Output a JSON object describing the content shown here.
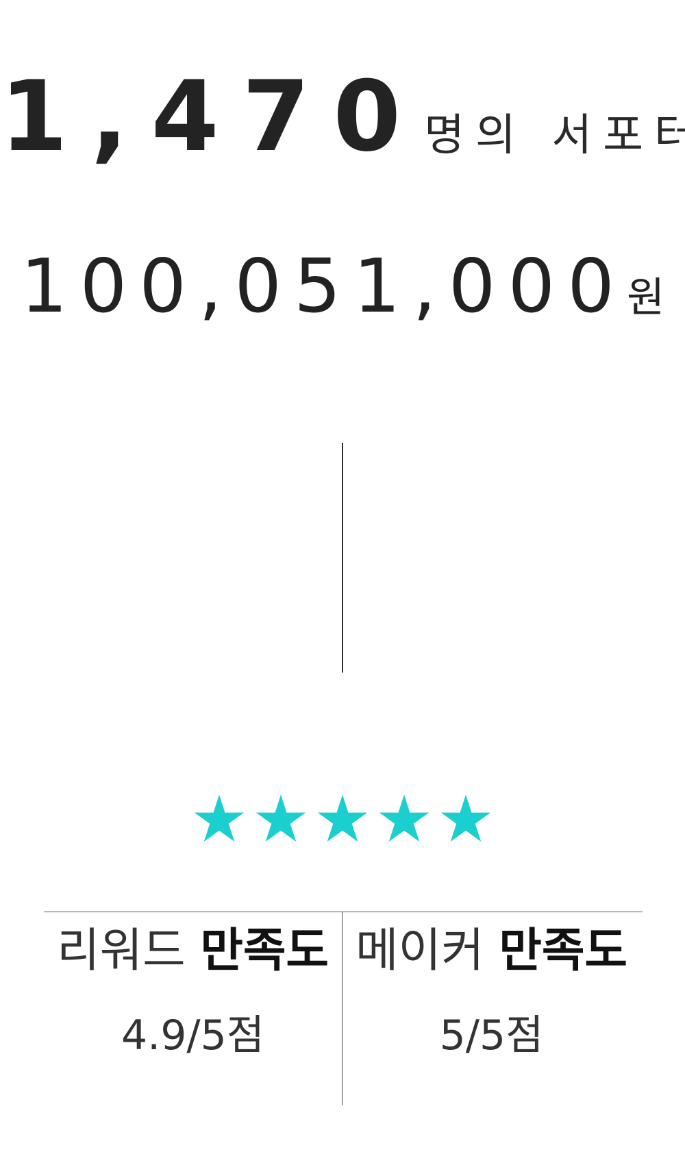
{
  "supporters": {
    "count": "1,470",
    "unit": "명의 서포터"
  },
  "funding": {
    "amount": "100,051,000",
    "unit": "원"
  },
  "rating": {
    "stars": 5,
    "max_stars": 5,
    "star_color": "#1ccfcf"
  },
  "satisfaction": {
    "reward": {
      "prefix": "리워드",
      "label": "만족도",
      "score": "4.9/5점"
    },
    "maker": {
      "prefix": "메이커",
      "label": "만족도",
      "score": "5/5점"
    }
  }
}
